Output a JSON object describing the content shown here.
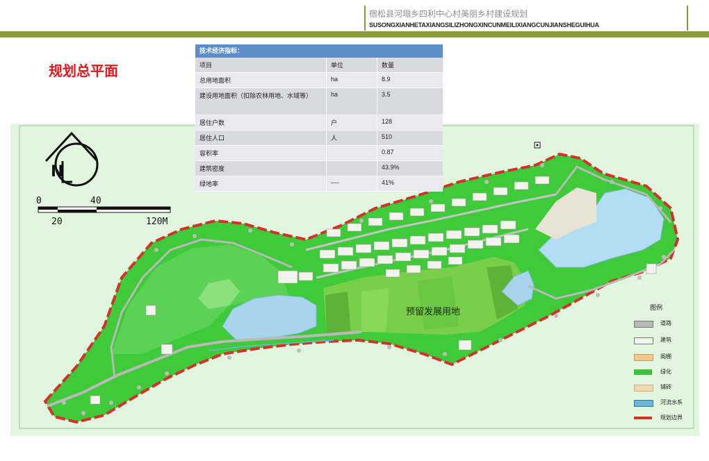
{
  "header": {
    "title": "宿松县河塌乡四利中心村美丽乡村建设规划",
    "subtitle": "SUSONGXIANHETAXIANGSILIZHONGXINCUNMEILIXIANGCUNJIANSHEGUIHUA"
  },
  "plan_title": "规划总平面",
  "table": {
    "heading": "技术经济指标：",
    "columns": [
      "项目",
      "单位",
      "数量"
    ],
    "rows": [
      [
        "总用地面积",
        "ha",
        "8.9"
      ],
      [
        "建设用地面积（扣除农林用地、水域等）",
        "ha",
        "3.5"
      ],
      [
        "居住户数",
        "户",
        "128"
      ],
      [
        "居住人口",
        "人",
        "510"
      ],
      [
        "容积率",
        "",
        "0.87"
      ],
      [
        "建筑密度",
        "",
        "43.9%"
      ],
      [
        "绿地率",
        "----",
        "41%"
      ]
    ]
  },
  "scale": {
    "t0": "0",
    "t40": "40",
    "t20": "20",
    "t120": "120M"
  },
  "north_letter": "N",
  "map": {
    "reserve_label": "预留发展用地"
  },
  "legend": {
    "title": "图例",
    "items": [
      {
        "label": "道路",
        "color": "#b9b9b9"
      },
      {
        "label": "建筑",
        "color": "#f4f4ee"
      },
      {
        "label": "阁棚",
        "color": "#f1c98e"
      },
      {
        "label": "绿化",
        "color": "#3fbf3a"
      },
      {
        "label": "铺砖",
        "color": "#f3d9b1"
      },
      {
        "label": "河流水系",
        "color": "#6fb6d4"
      },
      {
        "label": "规划边界",
        "color": "#d2322b"
      }
    ]
  },
  "colors": {
    "accent": "#8b9a3a",
    "title_red": "#e8151c",
    "table_head": "#5b8dc8",
    "green": "#3fca3a",
    "water": "#a8d4ec"
  }
}
